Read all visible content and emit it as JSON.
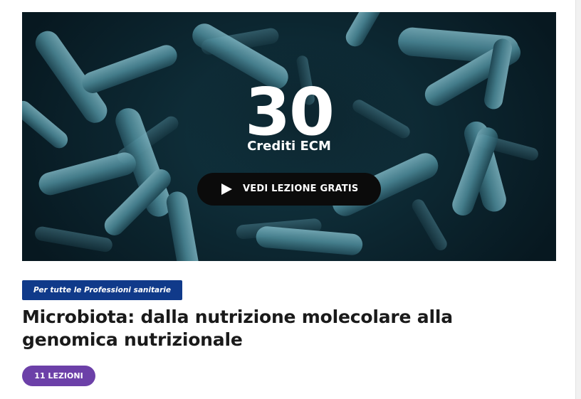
{
  "hero": {
    "credits_number": "30",
    "credits_label": "Crediti ECM",
    "cta_label": "VEDI LEZIONE GRATIS",
    "image_subject": "bacteria-microscopy-image"
  },
  "course": {
    "audience_tag": "Per tutte le Professioni sanitarie",
    "title": "Microbiota: dalla nutrizione molecolare alla genomica nutrizionale",
    "lessons_badge": "11 LEZIONI"
  },
  "colors": {
    "hero_background": "#0c2630",
    "bacteria": "#4f8d9c",
    "cta_background": "#0b0b0b",
    "audience_tag_background": "#103a8a",
    "lessons_badge_background": "#6c40a8",
    "title_text": "#1a1a1a"
  },
  "icons": {
    "cta_icon": "play-icon"
  }
}
